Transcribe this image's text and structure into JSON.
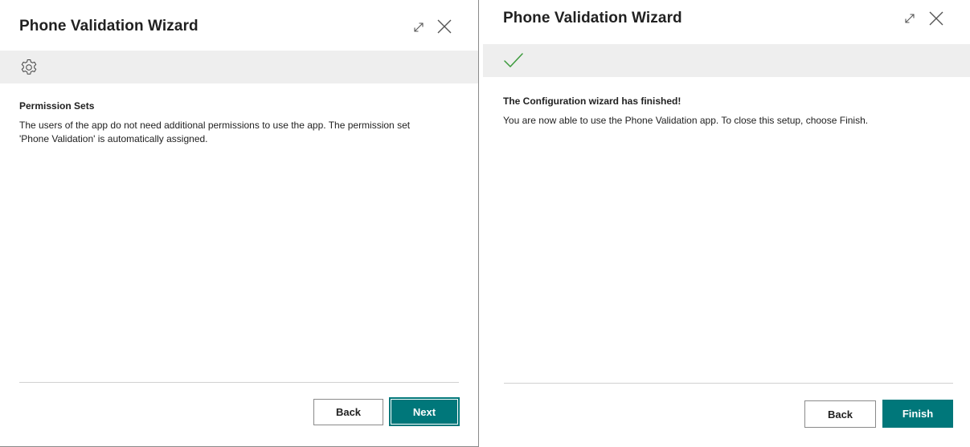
{
  "left_dialog": {
    "title": "Phone Validation Wizard",
    "banner_icon": "gear-icon",
    "section_title": "Permission Sets",
    "section_text": "The users of the app do not need additional permissions to use the app. The permission set 'Phone Validation' is automatically assigned.",
    "back_label": "Back",
    "next_label": "Next"
  },
  "right_dialog": {
    "title": "Phone Validation Wizard",
    "banner_icon": "checkmark-icon",
    "section_title": "The Configuration wizard has finished!",
    "section_text": "You are now able to use the Phone Validation app. To close this setup, choose Finish.",
    "back_label": "Back",
    "finish_label": "Finish"
  },
  "colors": {
    "primary": "#00777a",
    "banner_bg": "#eeeeee",
    "success": "#3c9a3c"
  }
}
